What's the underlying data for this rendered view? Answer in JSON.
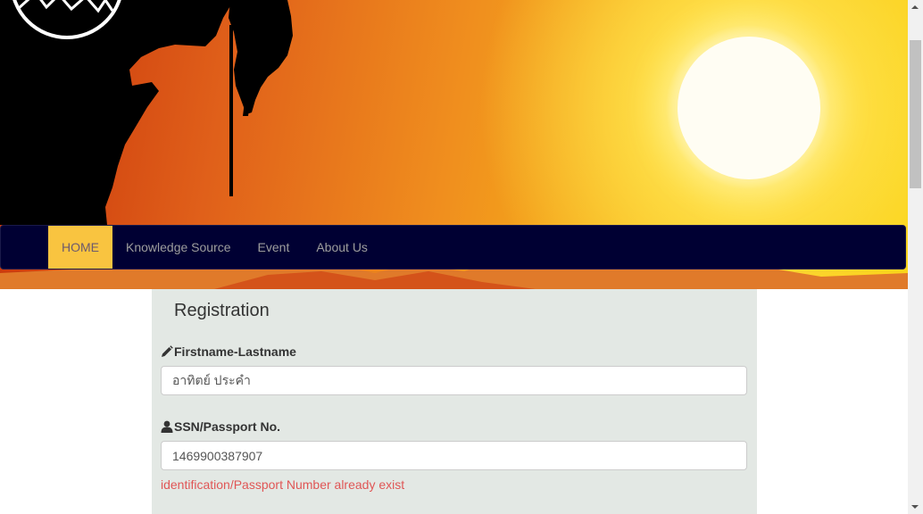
{
  "nav": {
    "items": [
      {
        "label": "HOME",
        "active": true
      },
      {
        "label": "Knowledge Source",
        "active": false
      },
      {
        "label": "Event",
        "active": false
      },
      {
        "label": "About Us",
        "active": false
      }
    ]
  },
  "registration": {
    "title": "Registration",
    "name_field": {
      "label": "Firstname-Lastname",
      "value": "อาทิตย์ ประคำ",
      "icon": "pencil-icon"
    },
    "ssn_field": {
      "label": "SSN/Passport No.",
      "value": "1469900387907",
      "icon": "user-icon"
    },
    "error_message": "identification/Passport Number already exist"
  },
  "colors": {
    "navbar_bg": "#000033",
    "nav_active_bg": "#f9c440",
    "panel_bg": "#e3e8e4",
    "error": "#e05656"
  }
}
